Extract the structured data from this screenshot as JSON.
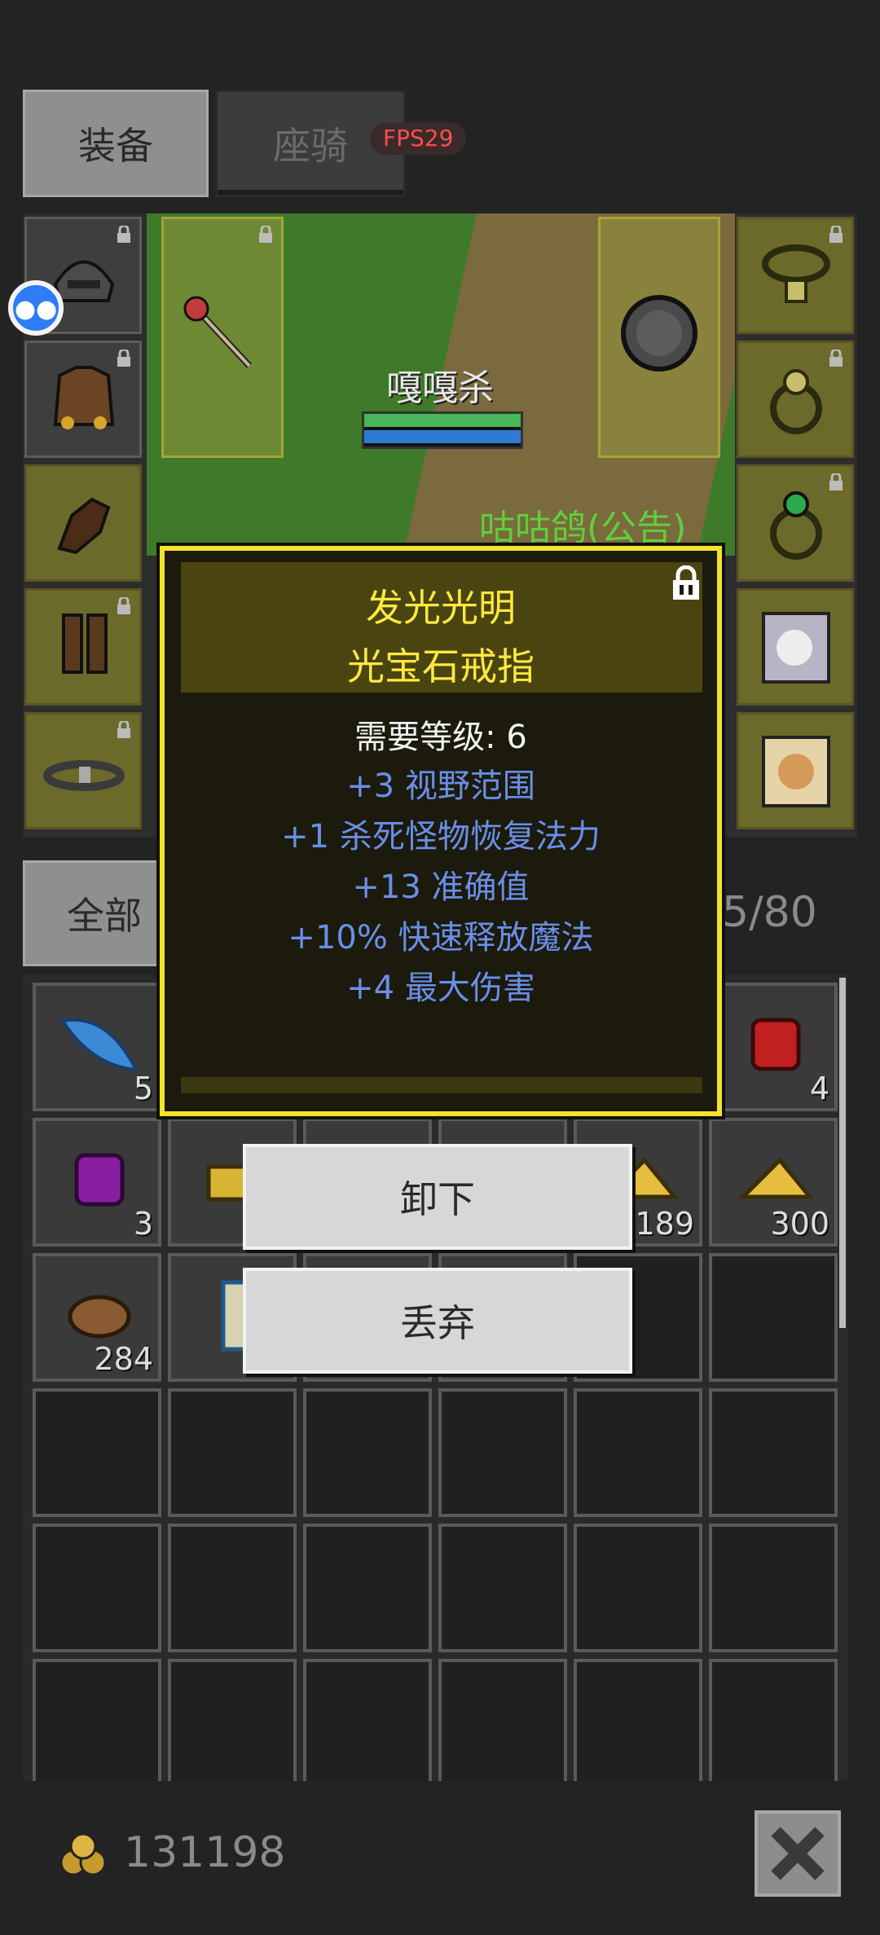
{
  "tabs": {
    "equip": "装备",
    "mount": "座骑"
  },
  "fps": "FPS29",
  "chat_icon": "chat-bubble-icon",
  "character": {
    "name": "嘎嘎杀",
    "hp": 1.0,
    "mp": 1.0
  },
  "npc": {
    "name": "咕咕鸽(公告)"
  },
  "gear_slots": {
    "left": [
      "helmet-icon",
      "armor-icon",
      "gloves-icon",
      "boots-icon",
      "belt-icon"
    ],
    "weapon": "staff-icon",
    "shield": "shield-icon",
    "right": [
      "necklace-icon",
      "ring-icon",
      "emerald-ring-icon",
      "pet-card-icon",
      "cat-card-icon"
    ]
  },
  "tooltip": {
    "title_line1": "发光光明",
    "title_line2": "光宝石戒指",
    "requirement": "需要等级: 6",
    "stats": [
      "+3 视野范围",
      "+1 杀死怪物恢复法力",
      "+13 准确值",
      "+10% 快速释放魔法",
      "+4 最大伤害"
    ],
    "colors": {
      "title": "#ffe940",
      "stat": "#6a8fe8",
      "border": "#f2e32e"
    }
  },
  "actions": {
    "unequip": "卸下",
    "discard": "丢弃"
  },
  "filter": {
    "all": "全部",
    "capacity": "5/80"
  },
  "inventory": {
    "row1": [
      {
        "icon": "blue-feather-icon",
        "qty": "5"
      },
      {
        "icon": "red-gem-icon",
        "qty": "4"
      }
    ],
    "row2": [
      {
        "icon": "purple-gem-icon",
        "qty": "3"
      },
      {
        "icon": "gold-ore-icon",
        "qty": ""
      },
      {
        "icon": "cheese-icon",
        "qty": "189"
      },
      {
        "icon": "cheese-icon",
        "qty": "300"
      }
    ],
    "row3": [
      {
        "icon": "meat-icon",
        "qty": "284"
      },
      {
        "icon": "scroll-icon",
        "qty": ""
      }
    ]
  },
  "gold": "131198",
  "close_icon": "close-icon"
}
